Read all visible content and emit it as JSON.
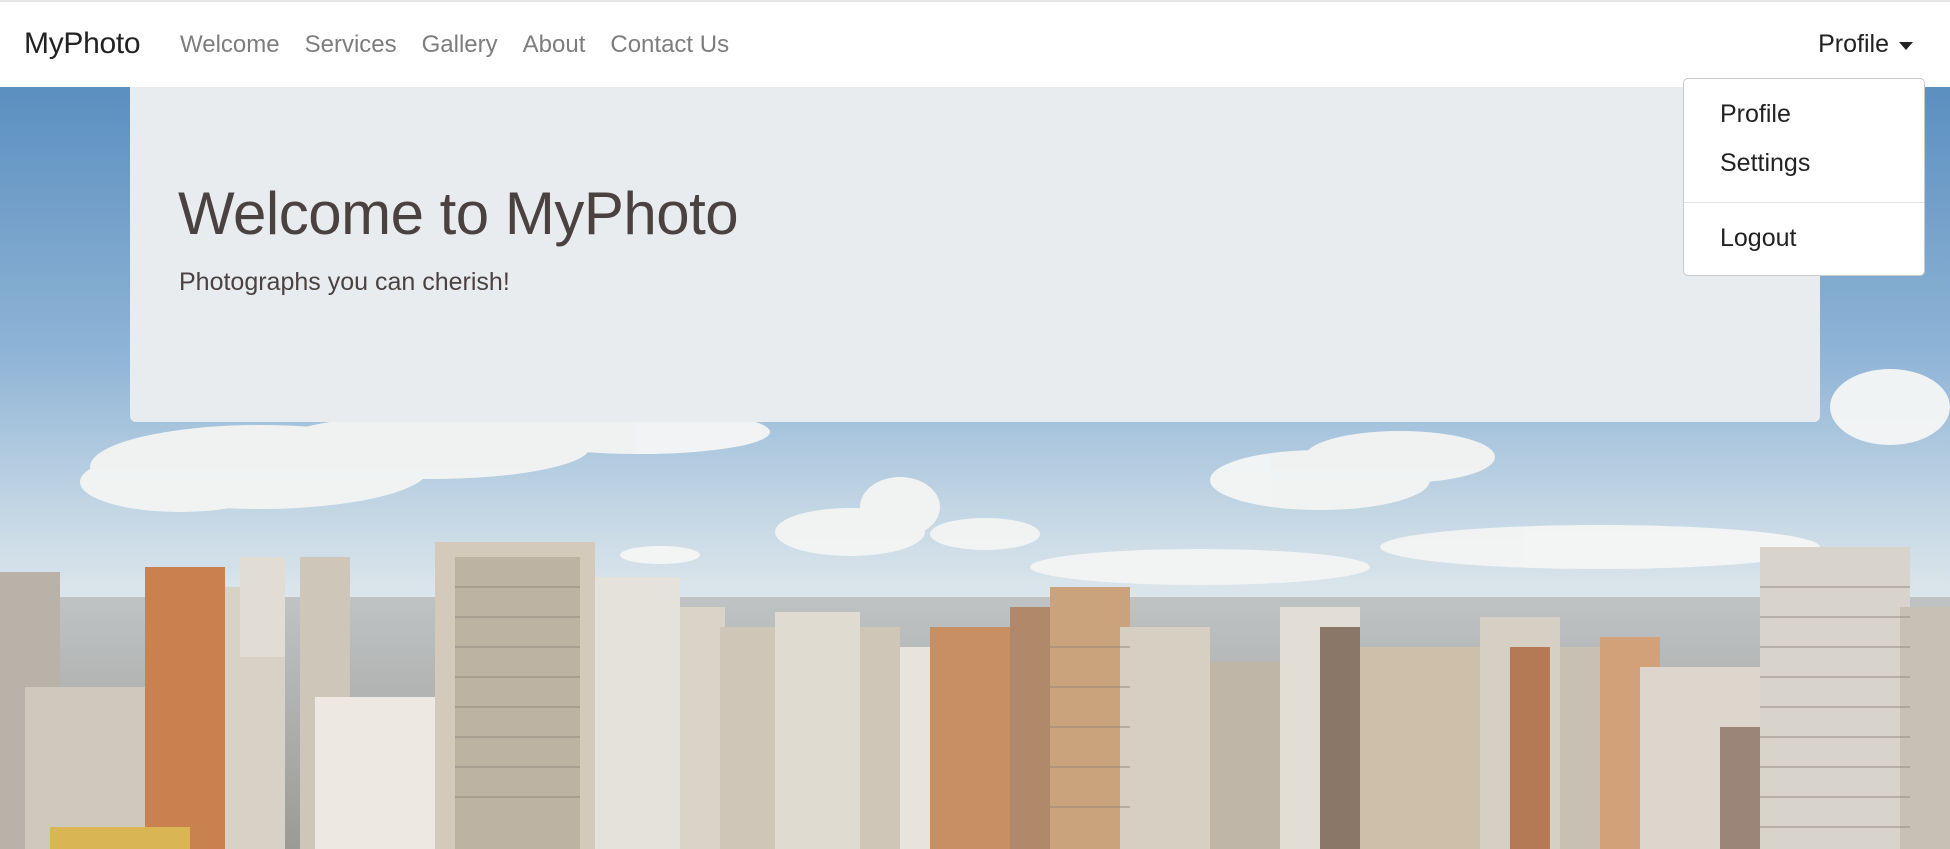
{
  "navbar": {
    "brand": "MyPhoto",
    "links": [
      "Welcome",
      "Services",
      "Gallery",
      "About",
      "Contact Us"
    ],
    "profile_label": "Profile"
  },
  "dropdown": {
    "items": [
      "Profile",
      "Settings"
    ],
    "logout": "Logout"
  },
  "jumbotron": {
    "title": "Welcome to MyPhoto",
    "lead": "Photographs you can cherish!"
  },
  "hero": {
    "image": "city-skyline-photo"
  },
  "colors": {
    "jumbotron_bg": "#e9ecef",
    "nav_text": "#7d7d7d",
    "title_text": "#4a4240"
  }
}
